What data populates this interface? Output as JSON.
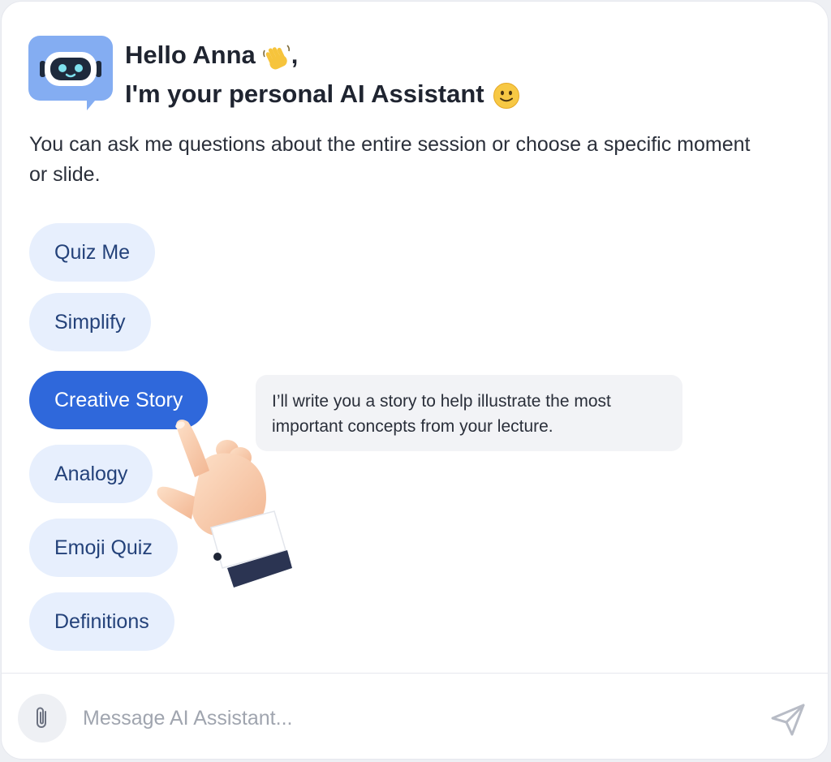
{
  "assistant": {
    "avatar_icon": "robot-chat-bubble-icon",
    "greeting_line1": "Hello Anna",
    "greeting_line1_suffix": ",",
    "greeting_line1_emoji": "waving-hand-icon",
    "greeting_line2": "I'm your personal AI Assistant",
    "greeting_line2_emoji": "slightly-smiling-face-icon",
    "intro": "You can ask me questions about the entire session or choose a specific moment or slide."
  },
  "actions": [
    {
      "label": "Quiz Me",
      "active": false
    },
    {
      "label": "Simplify",
      "active": false
    },
    {
      "label": "Creative Story",
      "active": true
    },
    {
      "label": "Analogy",
      "active": false
    },
    {
      "label": "Emoji Quiz",
      "active": false
    },
    {
      "label": "Definitions",
      "active": false
    }
  ],
  "tooltip": {
    "text": "I’ll write you a story to help illustrate the most important concepts from your lecture."
  },
  "composer": {
    "placeholder": "Message AI Assistant...",
    "attach_icon": "paperclip-icon",
    "send_icon": "send-icon"
  },
  "colors": {
    "accent": "#2f68db",
    "chip_bg": "#e7effd",
    "chip_text": "#24427a",
    "avatar_bg": "#84adf2"
  }
}
